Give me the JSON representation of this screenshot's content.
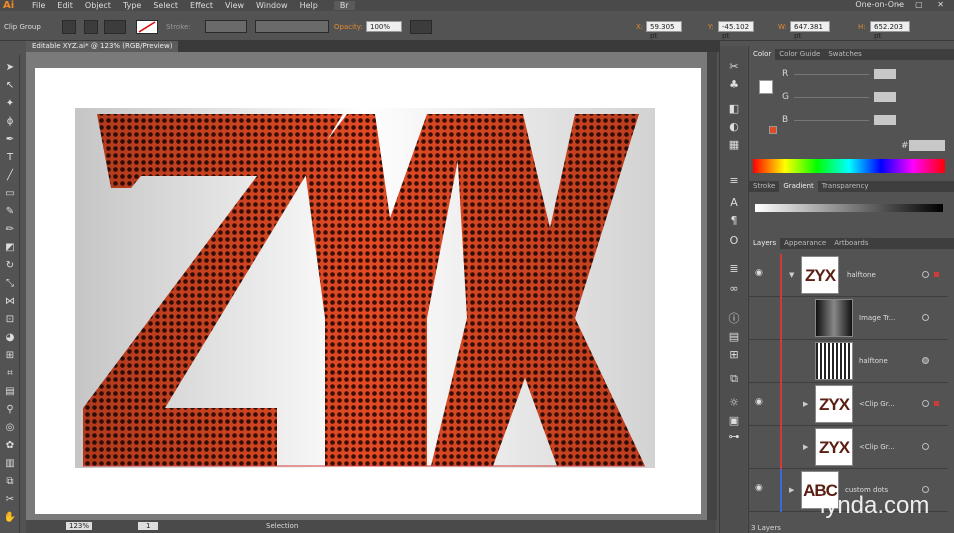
{
  "app": {
    "logo": "Ai",
    "workspace": "One-on-One",
    "win_controls": "– ▢ ✕",
    "bridge": "Br"
  },
  "menu": [
    "File",
    "Edit",
    "Object",
    "Type",
    "Select",
    "Effect",
    "View",
    "Window",
    "Help"
  ],
  "control": {
    "selection_label": "Clip Group",
    "stroke_label": "Stroke:",
    "opacity_label": "Opacity:",
    "opacity_value": "100%",
    "x_label": "X:",
    "x": "59.305 pt",
    "y_label": "Y:",
    "y": "-45.102 pt",
    "w_label": "W:",
    "w": "647.381 pt",
    "h_label": "H:",
    "h": "652.203 pt"
  },
  "document": {
    "tab": "Editable XYZ.ai* @ 123% (RGB/Preview)",
    "artwork_text": "ZYX"
  },
  "status": {
    "zoom": "123%",
    "page": "1",
    "tool": "Selection"
  },
  "color_panel": {
    "tabs": [
      "Color",
      "Color Guide",
      "Swatches"
    ],
    "channels": [
      "R",
      "G",
      "B"
    ],
    "hex_symbol": "#"
  },
  "gradient_panel": {
    "tabs": [
      "Stroke",
      "Gradient",
      "Transparency"
    ]
  },
  "layers_panel": {
    "tabs": [
      "Layers",
      "Appearance",
      "Artboards"
    ],
    "rows": [
      {
        "name": "halftone",
        "thumb": "ZYX",
        "type": "group"
      },
      {
        "name": "Image Tr...",
        "thumb": "",
        "type": "image"
      },
      {
        "name": "halftone",
        "thumb": "",
        "type": "gradient"
      },
      {
        "name": "<Clip Gr...",
        "thumb": "ZYX",
        "type": "clip"
      },
      {
        "name": "<Clip Gr...",
        "thumb": "ZYX",
        "type": "clip"
      },
      {
        "name": "custom dots",
        "thumb": "ABC",
        "type": "layer"
      }
    ],
    "footer": "3 Layers"
  },
  "watermark": "lynda.com",
  "colors": {
    "accent": "#e24a24",
    "dot": "#3a0e08",
    "selection": "#d23a3a"
  }
}
